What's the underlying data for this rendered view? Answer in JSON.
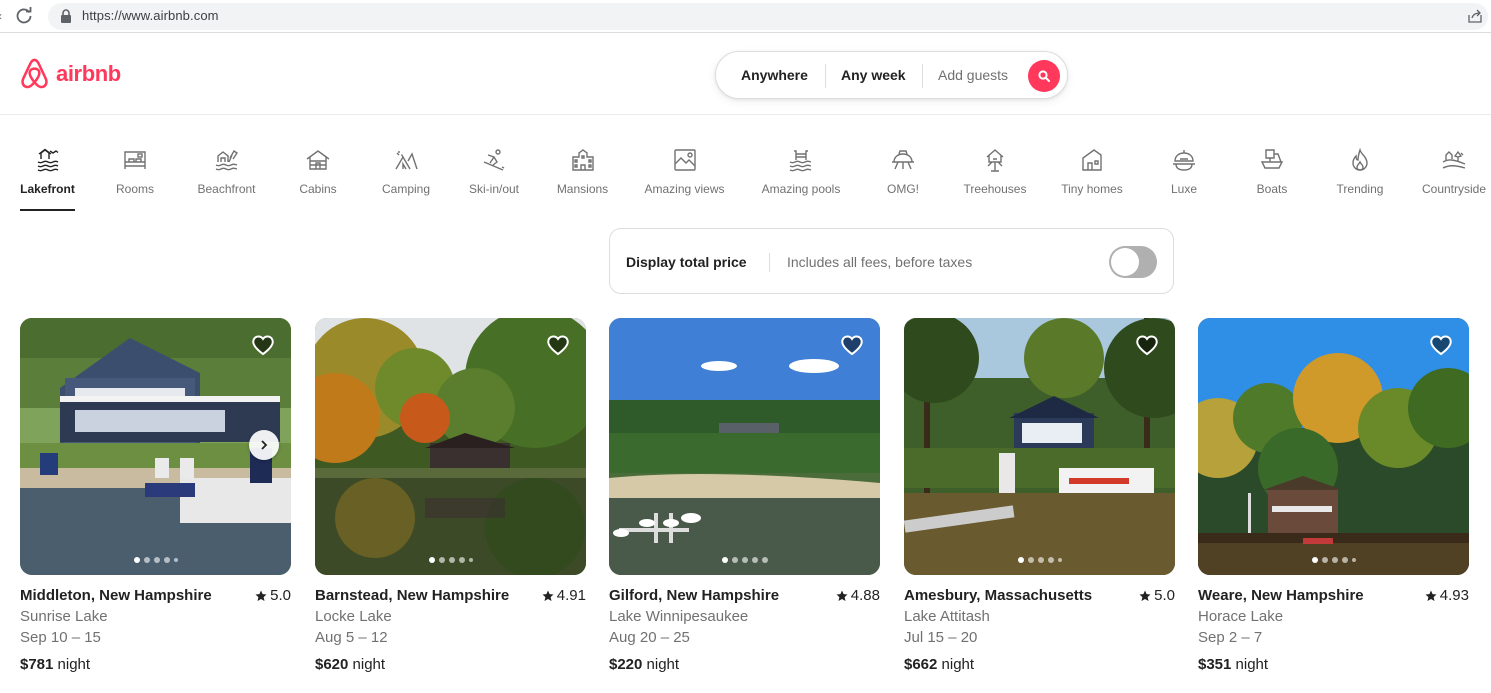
{
  "browser": {
    "url": "https://www.airbnb.com"
  },
  "header": {
    "logo_text": "airbnb",
    "search": {
      "anywhere": "Anywhere",
      "any_week": "Any week",
      "add_guests": "Add guests"
    }
  },
  "categories": [
    {
      "label": "Lakefront",
      "icon": "lakefront-icon",
      "active": true
    },
    {
      "label": "Rooms",
      "icon": "rooms-icon"
    },
    {
      "label": "Beachfront",
      "icon": "beachfront-icon"
    },
    {
      "label": "Cabins",
      "icon": "cabins-icon"
    },
    {
      "label": "Camping",
      "icon": "camping-icon"
    },
    {
      "label": "Ski-in/out",
      "icon": "ski-icon"
    },
    {
      "label": "Mansions",
      "icon": "mansions-icon"
    },
    {
      "label": "Amazing views",
      "icon": "amazing-views-icon"
    },
    {
      "label": "Amazing pools",
      "icon": "amazing-pools-icon"
    },
    {
      "label": "OMG!",
      "icon": "omg-icon"
    },
    {
      "label": "Treehouses",
      "icon": "treehouses-icon"
    },
    {
      "label": "Tiny homes",
      "icon": "tiny-homes-icon"
    },
    {
      "label": "Luxe",
      "icon": "luxe-icon"
    },
    {
      "label": "Boats",
      "icon": "boats-icon"
    },
    {
      "label": "Trending",
      "icon": "trending-icon"
    },
    {
      "label": "Countryside",
      "icon": "countryside-icon"
    }
  ],
  "price_toggle": {
    "title": "Display total price",
    "subtitle": "Includes all fees, before taxes",
    "enabled": false
  },
  "listings": [
    {
      "location": "Middleton, New Hampshire",
      "rating": "5.0",
      "place": "Sunrise Lake",
      "dates": "Sep 10 – 15",
      "price": "$781",
      "unit": " night"
    },
    {
      "location": "Barnstead, New Hampshire",
      "rating": "4.91",
      "place": "Locke Lake",
      "dates": "Aug 5 – 12",
      "price": "$620",
      "unit": " night"
    },
    {
      "location": "Gilford, New Hampshire",
      "rating": "4.88",
      "place": "Lake Winnipesaukee",
      "dates": "Aug 20 – 25",
      "price": "$220",
      "unit": " night"
    },
    {
      "location": "Amesbury, Massachusetts",
      "rating": "5.0",
      "place": "Lake Attitash",
      "dates": "Jul 15 – 20",
      "price": "$662",
      "unit": " night"
    },
    {
      "location": "Weare, New Hampshire",
      "rating": "4.93",
      "place": "Horace Lake",
      "dates": "Sep 2 – 7",
      "price": "$351",
      "unit": " night"
    }
  ],
  "colors": {
    "brand": "#ff385c",
    "text": "#222222",
    "muted": "#717171"
  }
}
